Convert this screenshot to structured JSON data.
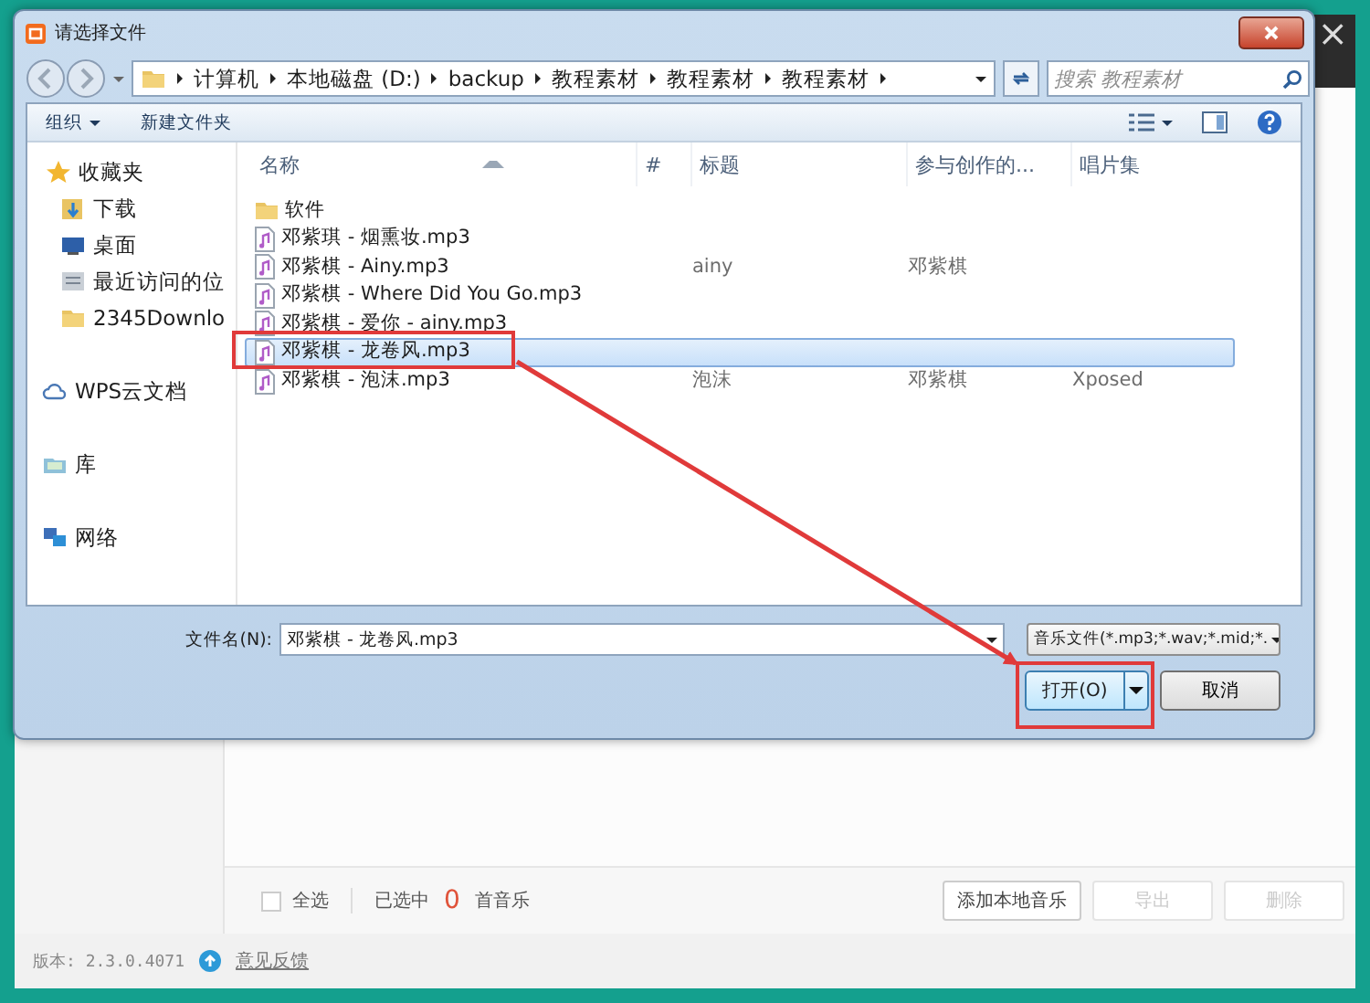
{
  "app": {
    "close": "×",
    "footer": {
      "select_all": {
        "label": "全选",
        "checked": false
      },
      "selected_prefix": "已选中",
      "selected_count": "0",
      "selected_suffix": "首音乐",
      "buttons": [
        {
          "label": "添加本地音乐",
          "disabled": false
        },
        {
          "label": "导出",
          "disabled": true
        },
        {
          "label": "删除",
          "disabled": true
        }
      ]
    },
    "status_bar": {
      "version": "版本: 2.3.0.4071",
      "feedback": "意见反馈"
    }
  },
  "dialog": {
    "title": "请选择文件",
    "breadcrumb": [
      "计算机",
      "本地磁盘 (D:)",
      "backup",
      "教程素材",
      "教程素材",
      "教程素材"
    ],
    "search": {
      "placeholder": "搜索 教程素材"
    },
    "toolbar": [
      {
        "label": "组织",
        "dropdown": true
      },
      {
        "label": "新建文件夹",
        "dropdown": false
      }
    ],
    "sidebar": {
      "items": [
        {
          "label": "收藏夹",
          "kind": "star",
          "group_start": false
        },
        {
          "label": "下载",
          "kind": "download",
          "group_start": false
        },
        {
          "label": "桌面",
          "kind": "desktop",
          "group_start": false
        },
        {
          "label": "最近访问的位",
          "kind": "recent",
          "group_start": false
        },
        {
          "label": "2345Downlo",
          "kind": "folder",
          "group_start": false
        },
        {
          "label": "WPS云文档",
          "kind": "cloud",
          "group_start": true
        },
        {
          "label": "库",
          "kind": "library",
          "group_start": true
        },
        {
          "label": "网络",
          "kind": "network",
          "group_start": true
        }
      ]
    },
    "columns": [
      "名称",
      "#",
      "标题",
      "参与创作的...",
      "唱片集"
    ],
    "rows": [
      {
        "kind": "folder",
        "name": "软件",
        "selected": false
      },
      {
        "kind": "audio",
        "name": "邓紫琪 - 烟熏妆.mp3",
        "selected": false
      },
      {
        "kind": "audio",
        "name": "邓紫棋 - Ainy.mp3",
        "title": "ainy",
        "artist": "邓紫棋",
        "selected": false
      },
      {
        "kind": "audio",
        "name": "邓紫棋 - Where Did You Go.mp3",
        "selected": false
      },
      {
        "kind": "audio",
        "name": "邓紫棋 - 爱你 - ainy.mp3",
        "selected": false
      },
      {
        "kind": "audio",
        "name": "邓紫棋 - 龙卷风.mp3",
        "selected": true
      },
      {
        "kind": "audio",
        "name": "邓紫棋 - 泡沫.mp3",
        "title": "泡沫",
        "artist": "邓紫棋",
        "album": "Xposed",
        "selected": false
      }
    ],
    "filename": {
      "label": "文件名(N):",
      "value": "邓紫棋 - 龙卷风.mp3"
    },
    "filter": "音乐文件(*.mp3;*.wav;*.mid;*.",
    "buttons": {
      "open": "打开(O)",
      "cancel": "取消"
    }
  }
}
